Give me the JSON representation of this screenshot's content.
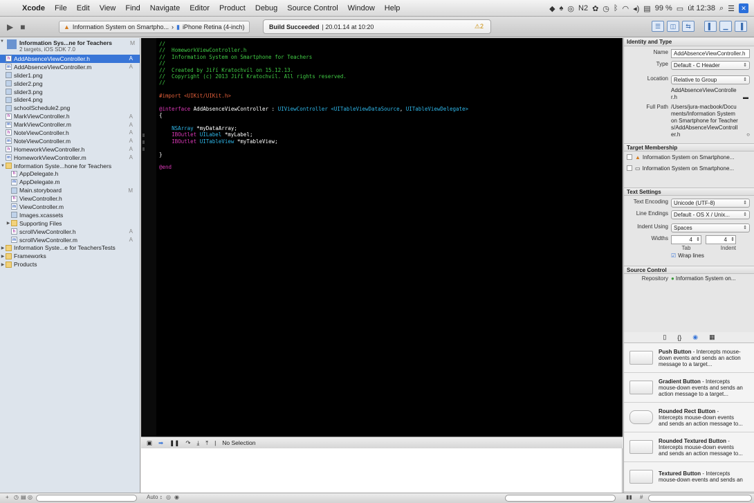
{
  "menubar": {
    "app": "Xcode",
    "items": [
      "File",
      "Edit",
      "View",
      "Find",
      "Navigate",
      "Editor",
      "Product",
      "Debug",
      "Source Control",
      "Window",
      "Help"
    ],
    "status_text": "Ν2",
    "battery": "99 %",
    "clock": "út 12:38"
  },
  "toolbar": {
    "scheme": "Information System on Smartpho...",
    "destination": "iPhone Retina (4-inch)",
    "activity_status": "Build Succeeded",
    "activity_time": "20.01.14 at 10:20",
    "warning_count": "2"
  },
  "navigator": {
    "project_name": "Information Sys...ne for Teachers",
    "project_sub": "2 targets, iOS SDK 7.0",
    "project_badge": "M",
    "rows": [
      {
        "label": "AddAbsenceViewController.h",
        "icon": "h",
        "badge": "A",
        "indent": 0,
        "selected": true
      },
      {
        "label": "AddAbsenceViewController.m",
        "icon": "m",
        "badge": "A",
        "indent": 0
      },
      {
        "label": "slider1.png",
        "icon": "img",
        "badge": "",
        "indent": 0
      },
      {
        "label": "slider2.png",
        "icon": "img",
        "badge": "",
        "indent": 0
      },
      {
        "label": "slider3.png",
        "icon": "img",
        "badge": "",
        "indent": 0
      },
      {
        "label": "slider4.png",
        "icon": "img",
        "badge": "",
        "indent": 0
      },
      {
        "label": "schoolSchedule2.png",
        "icon": "img",
        "badge": "",
        "indent": 0
      },
      {
        "label": "MarkViewController.h",
        "icon": "h",
        "badge": "A",
        "indent": 0
      },
      {
        "label": "MarkViewController.m",
        "icon": "m",
        "badge": "A",
        "indent": 0
      },
      {
        "label": "NoteViewController.h",
        "icon": "h",
        "badge": "A",
        "indent": 0
      },
      {
        "label": "NoteViewController.m",
        "icon": "m",
        "badge": "A",
        "indent": 0
      },
      {
        "label": "HomeworkViewController.h",
        "icon": "h",
        "badge": "A",
        "indent": 0
      },
      {
        "label": "HomeworkViewController.m",
        "icon": "m",
        "badge": "A",
        "indent": 0
      },
      {
        "label": "Information Syste...hone for Teachers",
        "icon": "folder",
        "badge": "",
        "indent": 0,
        "tri": "▼"
      },
      {
        "label": "AppDelegate.h",
        "icon": "h",
        "badge": "",
        "indent": 1
      },
      {
        "label": "AppDelegate.m",
        "icon": "m",
        "badge": "",
        "indent": 1
      },
      {
        "label": "Main.storyboard",
        "icon": "img",
        "badge": "M",
        "indent": 1
      },
      {
        "label": "ViewController.h",
        "icon": "h",
        "badge": "",
        "indent": 1
      },
      {
        "label": "ViewController.m",
        "icon": "m",
        "badge": "",
        "indent": 1
      },
      {
        "label": "Images.xcassets",
        "icon": "img",
        "badge": "",
        "indent": 1
      },
      {
        "label": "Supporting Files",
        "icon": "folder",
        "badge": "",
        "indent": 1,
        "tri": "▶"
      },
      {
        "label": "scrollViewController.h",
        "icon": "h",
        "badge": "A",
        "indent": 1
      },
      {
        "label": "scrollViewController.m",
        "icon": "m",
        "badge": "A",
        "indent": 1
      },
      {
        "label": "Information Syste...e for TeachersTests",
        "icon": "folder",
        "badge": "",
        "indent": 0,
        "tri": "▶"
      },
      {
        "label": "Frameworks",
        "icon": "folder",
        "badge": "",
        "indent": 0,
        "tri": "▶"
      },
      {
        "label": "Products",
        "icon": "folder",
        "badge": "",
        "indent": 0,
        "tri": "▶"
      }
    ]
  },
  "editor": {
    "lines": [
      [
        [
          "cmt",
          "//"
        ]
      ],
      [
        [
          "cmt",
          "//  HomeworkViewController.h"
        ]
      ],
      [
        [
          "cmt",
          "//  Information System on Smartphone for Teachers"
        ]
      ],
      [
        [
          "cmt",
          "//"
        ]
      ],
      [
        [
          "cmt",
          "//  Created by Jiří Kratochvíl on 15.12.13."
        ]
      ],
      [
        [
          "cmt",
          "//  Copyright (c) 2013 Jiří Kratochvíl. All rights reserved."
        ]
      ],
      [
        [
          "cmt",
          "//"
        ]
      ],
      [],
      [
        [
          "pp",
          "#import <UIKit/UIKit.h>"
        ]
      ],
      [],
      [
        [
          "kw",
          "@interface"
        ],
        [
          "pl",
          " AddAbsenceViewController : "
        ],
        [
          "ty",
          "UIViewController"
        ],
        [
          "pl",
          " "
        ],
        [
          "ty",
          "<UITableViewDataSource"
        ],
        [
          "pl",
          ", "
        ],
        [
          "ty",
          "UITableViewDelegate>"
        ]
      ],
      [
        [
          "pl",
          "{"
        ]
      ],
      [],
      [
        [
          "pl",
          "    "
        ],
        [
          "ty",
          "NSArray"
        ],
        [
          "pl",
          " *myDataArray;"
        ]
      ],
      [
        [
          "pl",
          "    "
        ],
        [
          "kw",
          "IBOutlet"
        ],
        [
          "pl",
          " "
        ],
        [
          "ty",
          "UILabel"
        ],
        [
          "pl",
          " *myLabel;"
        ]
      ],
      [
        [
          "pl",
          "    "
        ],
        [
          "kw",
          "IBOutlet"
        ],
        [
          "pl",
          " "
        ],
        [
          "ty",
          "UITableView"
        ],
        [
          "pl",
          " *myTableView;"
        ]
      ],
      [],
      [
        [
          "pl",
          "}"
        ]
      ],
      [],
      [
        [
          "kw",
          "@end"
        ]
      ]
    ]
  },
  "debugbar": {
    "selection": "No Selection"
  },
  "bottombar": {
    "auto_label": "Auto"
  },
  "inspector": {
    "identity_header": "Identity and Type",
    "name_label": "Name",
    "name_value": "AddAbsenceViewController.h",
    "type_label": "Type",
    "type_value": "Default - C Header",
    "location_label": "Location",
    "location_value": "Relative to Group",
    "location_path": "AddAbsenceViewController.h",
    "fullpath_label": "Full Path",
    "fullpath_value": "/Users/jura-macbook/Documents/Information System on Smartphone for Teachers/AddAbsenceViewController.h",
    "target_header": "Target Membership",
    "targets": [
      "Information System on Smartphone...",
      "Information System on Smartphone..."
    ],
    "text_header": "Text Settings",
    "encoding_label": "Text Encoding",
    "encoding_value": "Unicode (UTF-8)",
    "endings_label": "Line Endings",
    "endings_value": "Default - OS X / Unix...",
    "indent_label": "Indent Using",
    "indent_value": "Spaces",
    "widths_label": "Widths",
    "tab_width": "4",
    "indent_width": "4",
    "tab_caption": "Tab",
    "indent_caption": "Indent",
    "wrap_label": "Wrap lines",
    "source_header": "Source Control",
    "repository_label": "Repository",
    "repository_value": "Information System on..."
  },
  "library": {
    "items": [
      {
        "title": "Push Button",
        "desc": " - Intercepts mouse-down events and sends an action message to a target...",
        "shape": "rect"
      },
      {
        "title": "Gradient Button",
        "desc": " - Intercepts mouse-down events and sends an action message to a target...",
        "shape": "rect"
      },
      {
        "title": "Rounded Rect Button",
        "desc": " - Intercepts mouse-down events and sends an action message to...",
        "shape": "round"
      },
      {
        "title": "Rounded Textured Button",
        "desc": " - Intercepts mouse-down events and sends an action message to...",
        "shape": "rect"
      },
      {
        "title": "Textured Button",
        "desc": " - Intercepts mouse-down events and sends an",
        "shape": "rect"
      }
    ]
  }
}
